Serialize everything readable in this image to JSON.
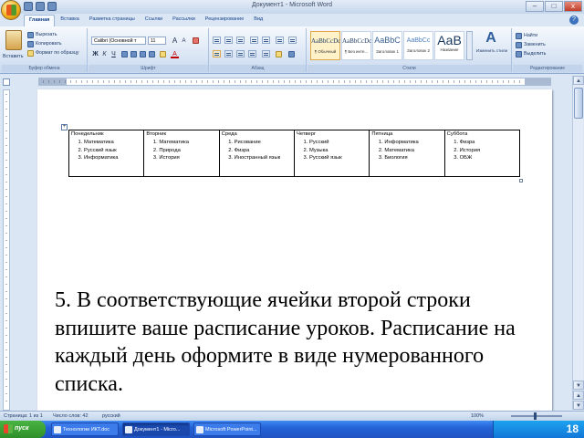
{
  "window": {
    "title": "Документ1 - Microsoft Word"
  },
  "window_controls": {
    "minimize": "–",
    "maximize": "□",
    "close": "x"
  },
  "tabs": [
    "Главная",
    "Вставка",
    "Разметка страницы",
    "Ссылки",
    "Рассылки",
    "Рецензирование",
    "Вид"
  ],
  "help_icon": "?",
  "ribbon": {
    "clipboard": {
      "label": "Буфер обмена",
      "paste": "Вставить",
      "cut": "Вырезать",
      "copy": "Копировать",
      "format_painter": "Формат по образцу"
    },
    "font": {
      "label": "Шрифт",
      "name": "Calibri (Основной т",
      "size": "11",
      "bold": "Ж",
      "italic": "К",
      "underline": "Ч",
      "grow": "A",
      "shrink": "A",
      "color": "A"
    },
    "paragraph": {
      "label": "Абзац"
    },
    "styles": {
      "label": "Стили",
      "items": [
        {
          "sample": "AaBbCcDc",
          "name": "¶ Обычный"
        },
        {
          "sample": "AaBbCcDc",
          "name": "¶ Без инте..."
        },
        {
          "sample": "AaBbC",
          "name": "Заголовок 1"
        },
        {
          "sample": "AaBbCc",
          "name": "Заголовок 2"
        },
        {
          "sample": "АаВ",
          "name": "Название"
        }
      ],
      "change": "Изменить стили"
    },
    "editing": {
      "label": "Редактирование",
      "find": "Найти",
      "replace": "Заменить",
      "select": "Выделить"
    }
  },
  "document": {
    "table": {
      "days": [
        "Понедельник",
        "Вторник",
        "Среда",
        "Четверг",
        "Пятница",
        "Суббота"
      ],
      "lessons": [
        [
          "Математика",
          "Русский язык",
          "Информатика"
        ],
        [
          "Математика",
          "Природа",
          "История"
        ],
        [
          "Рисование",
          "Физра",
          "Иностранный язык"
        ],
        [
          "Русский",
          "Музыка",
          "Русский язык"
        ],
        [
          "Информатика",
          "Математика",
          "Биология"
        ],
        [
          "Физра",
          "История",
          "ОБЖ"
        ]
      ]
    },
    "instruction": "5. В соответствующие ячейки второй строки впишите ваше расписание уроков. Расписание на каждый день оформите в виде нумерованного списка."
  },
  "statusbar": {
    "page": "Страница: 1 из 1",
    "words": "Число слов: 42",
    "language": "русский",
    "zoom": "100%"
  },
  "taskbar": {
    "start": "пуск",
    "tasks": [
      "Технологии ИКТ.doc",
      "Документ1 - Micro...",
      "Microsoft PowerPoint..."
    ],
    "slide_number": "18"
  }
}
